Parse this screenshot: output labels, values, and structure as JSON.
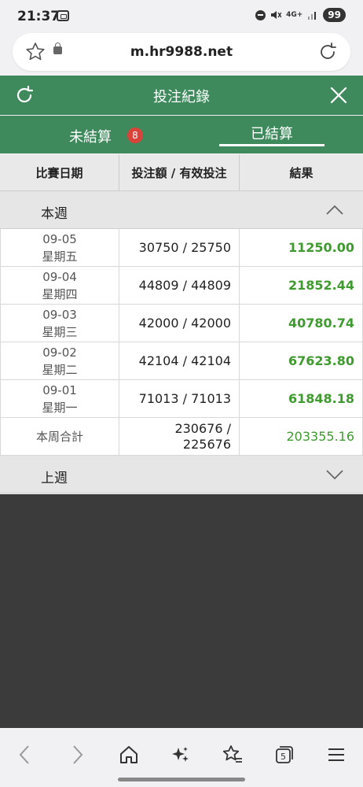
{
  "status_bar": {
    "time": "21:37",
    "network": "4G+",
    "battery": "99"
  },
  "browser": {
    "url": "m.hr9988.net"
  },
  "header": {
    "title": "投注紀錄"
  },
  "tabs": [
    {
      "label": "未結算",
      "badge": "8"
    },
    {
      "label": "已結算"
    }
  ],
  "table": {
    "columns": [
      "比賽日期",
      "投注額 / 有效投注",
      "結果"
    ],
    "this_week": {
      "title": "本週",
      "rows": [
        {
          "date": "09-05",
          "weekday": "星期五",
          "bet": "30750 / 25750",
          "result": "11250.00"
        },
        {
          "date": "09-04",
          "weekday": "星期四",
          "bet": "44809 / 44809",
          "result": "21852.44"
        },
        {
          "date": "09-03",
          "weekday": "星期三",
          "bet": "42000 / 42000",
          "result": "40780.74"
        },
        {
          "date": "09-02",
          "weekday": "星期二",
          "bet": "42104 / 42104",
          "result": "67623.80"
        },
        {
          "date": "09-01",
          "weekday": "星期一",
          "bet": "71013 / 71013",
          "result": "61848.18"
        }
      ],
      "total": {
        "label": "本周合計",
        "bet_line1": "230676 /",
        "bet_line2": "225676",
        "result": "203355.16"
      }
    },
    "last_week": {
      "title": "上週"
    }
  },
  "colors": {
    "header_green": "#3e8a5c",
    "result_green": "#3f9a2f",
    "badge_red": "#d9433a"
  }
}
